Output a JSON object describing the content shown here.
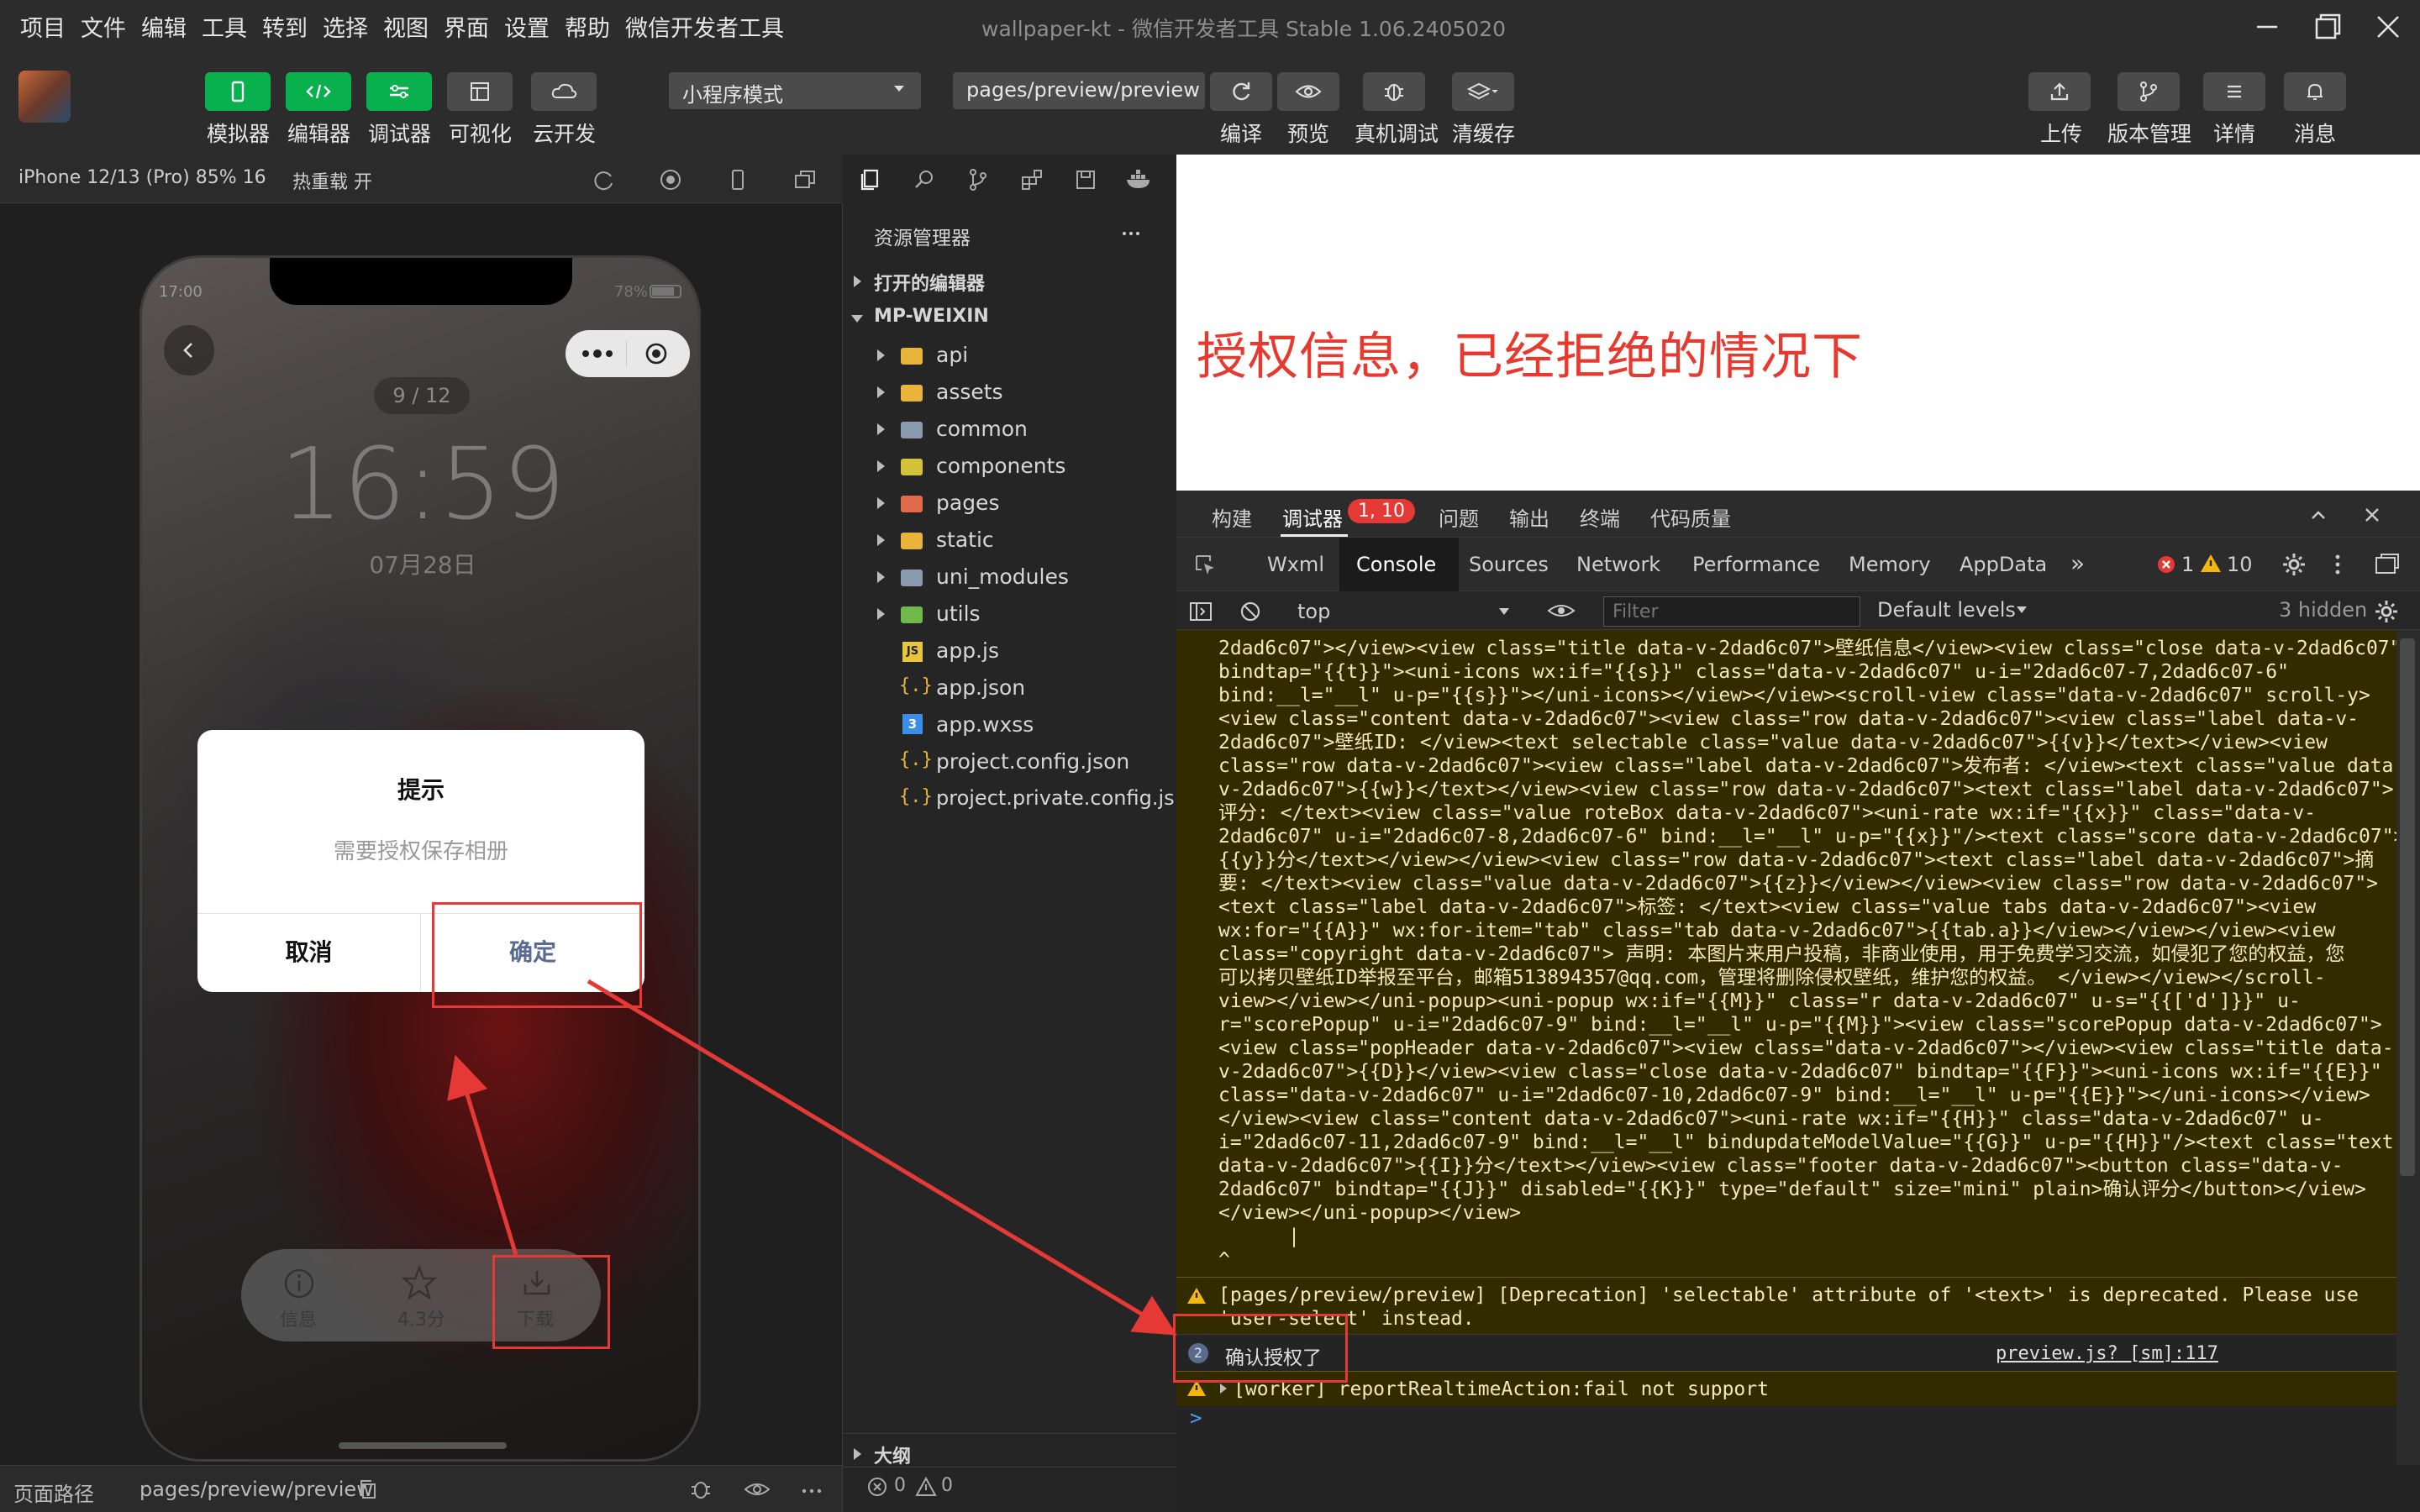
{
  "menubar": {
    "items": [
      "项目",
      "文件",
      "编辑",
      "工具",
      "转到",
      "选择",
      "视图",
      "界面",
      "设置",
      "帮助",
      "微信开发者工具"
    ],
    "title": "wallpaper-kt - 微信开发者工具 Stable 1.06.2405020"
  },
  "toolbar": {
    "left_buttons": [
      "模拟器",
      "编辑器",
      "调试器",
      "可视化",
      "云开发"
    ],
    "mode_select": "小程序模式",
    "page_select": "pages/preview/preview",
    "center_buttons": [
      "编译",
      "预览",
      "真机调试",
      "清缓存"
    ],
    "right_buttons": [
      "上传",
      "版本管理",
      "详情",
      "消息"
    ]
  },
  "simulator": {
    "device": "iPhone 12/13 (Pro) 85% 16",
    "hotreload": "热重载 开",
    "time_status": "17:00",
    "battery": "78%",
    "counter": "9 / 12",
    "clock": "16:59",
    "date": "07月28日",
    "dialog": {
      "title": "提示",
      "content": "需要授权保存相册",
      "cancel": "取消",
      "confirm": "确定"
    },
    "bottom": {
      "info": "信息",
      "score": "4.3分",
      "download": "下载"
    }
  },
  "statusbar": {
    "label": "页面路径",
    "path": "pages/preview/preview",
    "errors": "0",
    "warnings": "0"
  },
  "explorer": {
    "title": "资源管理器",
    "open_editors": "打开的编辑器",
    "project": "MP-WEIXIN",
    "folders": [
      "api",
      "assets",
      "common",
      "components",
      "pages",
      "static",
      "uni_modules",
      "utils"
    ],
    "files": [
      "app.js",
      "app.json",
      "app.wxss",
      "project.config.json",
      "project.private.config.js..."
    ],
    "outline": "大纲"
  },
  "annotation": {
    "text": "授权信息，已经拒绝的情况下"
  },
  "devtools": {
    "top_tabs": [
      "构建",
      "调试器",
      "问题",
      "输出",
      "终端",
      "代码质量"
    ],
    "debugger_badge": "1, 10",
    "panel_tabs": [
      "Wxml",
      "Console",
      "Sources",
      "Network",
      "Performance",
      "Memory",
      "AppData"
    ],
    "error_count": "1",
    "warn_count": "10",
    "context": "top",
    "filter_placeholder": "Filter",
    "levels": "Default levels",
    "hidden": "3 hidden",
    "log_lines": [
      "2dad6c07\"></view><view class=\"title data-v-2dad6c07\">壁纸信息</view><view class=\"close data-v-2dad6c07\"",
      "bindtap=\"{{t}}\"><uni-icons wx:if=\"{{s}}\" class=\"data-v-2dad6c07\" u-i=\"2dad6c07-7,2dad6c07-6\"",
      "bind:__l=\"__l\" u-p=\"{{s}}\"></uni-icons></view></view><scroll-view class=\"data-v-2dad6c07\" scroll-y>",
      "<view class=\"content data-v-2dad6c07\"><view class=\"row data-v-2dad6c07\"><view class=\"label data-v-",
      "2dad6c07\">壁纸ID: </view><text selectable class=\"value data-v-2dad6c07\">{{v}}</text></view><view",
      "class=\"row data-v-2dad6c07\"><view class=\"label data-v-2dad6c07\">发布者: </view><text class=\"value data-",
      "v-2dad6c07\">{{w}}</text></view><view class=\"row data-v-2dad6c07\"><text class=\"label data-v-2dad6c07\">",
      "评分: </text><view class=\"value roteBox data-v-2dad6c07\"><uni-rate wx:if=\"{{x}}\" class=\"data-v-",
      "2dad6c07\" u-i=\"2dad6c07-8,2dad6c07-6\" bind:__l=\"__l\" u-p=\"{{x}}\"/><text class=\"score data-v-2dad6c07\">",
      "{{y}}分</text></view></view><view class=\"row data-v-2dad6c07\"><text class=\"label data-v-2dad6c07\">摘",
      "要: </text><view class=\"value data-v-2dad6c07\">{{z}}</view></view><view class=\"row data-v-2dad6c07\">",
      "<text class=\"label data-v-2dad6c07\">标签: </text><view class=\"value tabs data-v-2dad6c07\"><view",
      "wx:for=\"{{A}}\" wx:for-item=\"tab\" class=\"tab data-v-2dad6c07\">{{tab.a}}</view></view></view><view",
      "class=\"copyright data-v-2dad6c07\"> 声明: 本图片来用户投稿，非商业使用，用于免费学习交流，如侵犯了您的权益，您",
      "可以拷贝壁纸ID举报至平台，邮箱513894357@qq.com，管理将删除侵权壁纸，维护您的权益。 </view></view></scroll-",
      "view></view></uni-popup><uni-popup wx:if=\"{{M}}\" class=\"r data-v-2dad6c07\" u-s=\"{{['d']}}\" u-",
      "r=\"scorePopup\" u-i=\"2dad6c07-9\" bind:__l=\"__l\" u-p=\"{{M}}\"><view class=\"scorePopup data-v-2dad6c07\">",
      "<view class=\"popHeader data-v-2dad6c07\"><view class=\"data-v-2dad6c07\"></view><view class=\"title data-",
      "v-2dad6c07\">{{D}}</view><view class=\"close data-v-2dad6c07\" bindtap=\"{{F}}\"><uni-icons wx:if=\"{{E}}\"",
      "class=\"data-v-2dad6c07\" u-i=\"2dad6c07-10,2dad6c07-9\" bind:__l=\"__l\" u-p=\"{{E}}\"></uni-icons></view>",
      "</view><view class=\"content data-v-2dad6c07\"><uni-rate wx:if=\"{{H}}\" class=\"data-v-2dad6c07\" u-",
      "i=\"2dad6c07-11,2dad6c07-9\" bind:__l=\"__l\" bindupdateModelValue=\"{{G}}\" u-p=\"{{H}}\"/><text class=\"text",
      "data-v-2dad6c07\">{{I}}分</text></view><view class=\"footer data-v-2dad6c07\"><button class=\"data-v-",
      "2dad6c07\" bindtap=\"{{J}}\" disabled=\"{{K}}\" type=\"default\" size=\"mini\" plain>确认评分</button></view>",
      "</view></uni-popup></view>",
      "      |",
      "^"
    ],
    "warning1_line1": "[pages/preview/preview] [Deprecation] 'selectable' attribute of '<text>' is deprecated. Please use",
    "warning1_line2": "'user-select' instead.",
    "info_count": "2",
    "info_text": "确认授权了",
    "info_source": "preview.js? [sm]:117",
    "warning2": "[worker] reportRealtimeAction:fail not support",
    "prompt_symbol": ">"
  },
  "colors": {
    "accent_green": "#08b14e",
    "annotation_red": "#e8392e",
    "confirm_blue": "#576b95"
  }
}
